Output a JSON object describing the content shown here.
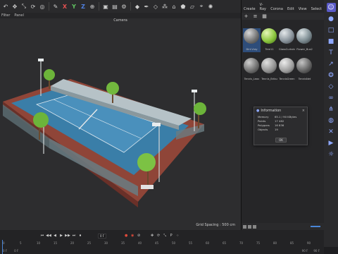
{
  "toolbar": {
    "axis_x": "X",
    "axis_y": "Y",
    "axis_z": "Z"
  },
  "menubar": {
    "items": [
      "Filter",
      "Panel"
    ]
  },
  "viewport": {
    "camera_label": "Camera",
    "grid_spacing": "Grid Spacing : 500 cm"
  },
  "material_panel": {
    "menu": [
      "Create",
      "V-Ray",
      "Corona",
      "Edit",
      "View",
      "Select"
    ],
    "materials": [
      {
        "label": "Dirt.Vray",
        "color": "#8a8a8a",
        "selected": true
      },
      {
        "label": "Tree11",
        "color": "#8cc63f",
        "selected": false
      },
      {
        "label": "GlassCurtain",
        "color": "#9aa4ad",
        "selected": false
      },
      {
        "label": "Flower_Bus2",
        "color": "#7d8c92",
        "selected": false
      },
      {
        "label": "Tennis_Leav",
        "color": "#7c7c7c",
        "selected": false
      },
      {
        "label": "Tennis_Bribu",
        "color": "#9a9a9a",
        "selected": false
      },
      {
        "label": "TennisGreen",
        "color": "#a3a3a3",
        "selected": false
      },
      {
        "label": "TennisNet",
        "color": "#6b6b6b",
        "selected": false
      }
    ]
  },
  "info_dialog": {
    "title": "Information",
    "close": "×",
    "rows": [
      {
        "key": "Memory",
        "value": "65.1 / 90 KBytes"
      },
      {
        "key": "Points",
        "value": "17 482"
      },
      {
        "key": "Polygons",
        "value": "16 836"
      },
      {
        "key": "Objects",
        "value": "19"
      }
    ],
    "ok_label": "OK"
  },
  "timeline": {
    "frame_start": "0 F",
    "frame_current": "0 F",
    "frame_end": "90 F",
    "ticks": [
      "0",
      "5",
      "10",
      "15",
      "20",
      "25",
      "30",
      "35",
      "40",
      "45",
      "50",
      "55",
      "60",
      "65",
      "70",
      "75",
      "80",
      "85",
      "90"
    ],
    "bottom_left": "0 F",
    "bottom_mid": "0 F",
    "bottom_right_a": "90 F",
    "bottom_right_b": "90 F"
  },
  "colors": {
    "accent": "#4a86d8",
    "court_blue": "#3f7fa6",
    "court_surround": "#a05040",
    "record_red": "#e04a3a"
  }
}
